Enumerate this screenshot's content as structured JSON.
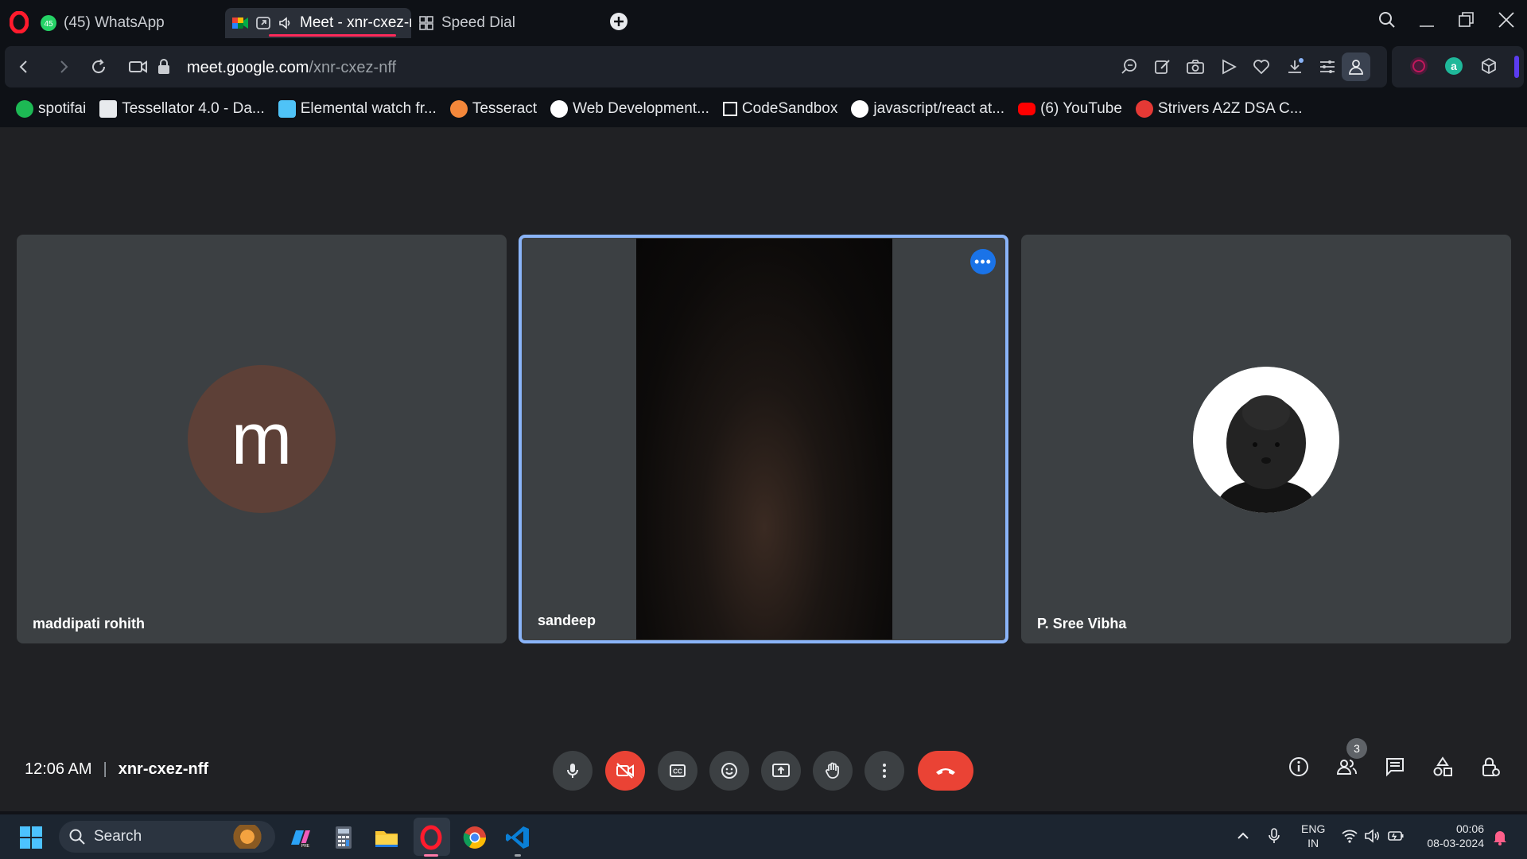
{
  "browser": {
    "tabs": [
      {
        "label": "(45) WhatsApp",
        "badge": "45"
      },
      {
        "label": "Meet - xnr-cxez-nff"
      },
      {
        "label": "Speed Dial"
      }
    ],
    "url_host": "meet.google.com",
    "url_path": "/xnr-cxez-nff",
    "bookmarks": [
      {
        "label": "spotifai",
        "color": "#1db954"
      },
      {
        "label": "Tessellator 4.0 - Da...",
        "color": "#e8eaed"
      },
      {
        "label": "Elemental watch fr...",
        "color": "#4fc3f7"
      },
      {
        "label": "Tesseract",
        "color": "#f4873a"
      },
      {
        "label": "Web Development...",
        "color": "#ffffff"
      },
      {
        "label": "CodeSandbox",
        "color": "#ffffff"
      },
      {
        "label": "javascript/react at...",
        "color": "#ffffff"
      },
      {
        "label": "(6) YouTube",
        "color": "#ff0000"
      },
      {
        "label": "Strivers A2Z DSA C...",
        "color": "#e53935"
      }
    ]
  },
  "meet": {
    "participants": [
      {
        "name": "maddipati rohith",
        "initial": "m",
        "avatar_color": "#5d4037"
      },
      {
        "name": "sandeep"
      },
      {
        "name": "P. Sree Vibha"
      }
    ],
    "time": "12:06 AM",
    "meeting_code": "xnr-cxez-nff",
    "people_count": "3",
    "colors": {
      "accent": "#8ab4f8",
      "danger": "#ea4335",
      "tile": "#3c4043",
      "background": "#202124"
    }
  },
  "taskbar": {
    "search_label": "Search",
    "lang_line1": "ENG",
    "lang_line2": "IN",
    "clock_time": "00:06",
    "clock_date": "08-03-2024"
  }
}
